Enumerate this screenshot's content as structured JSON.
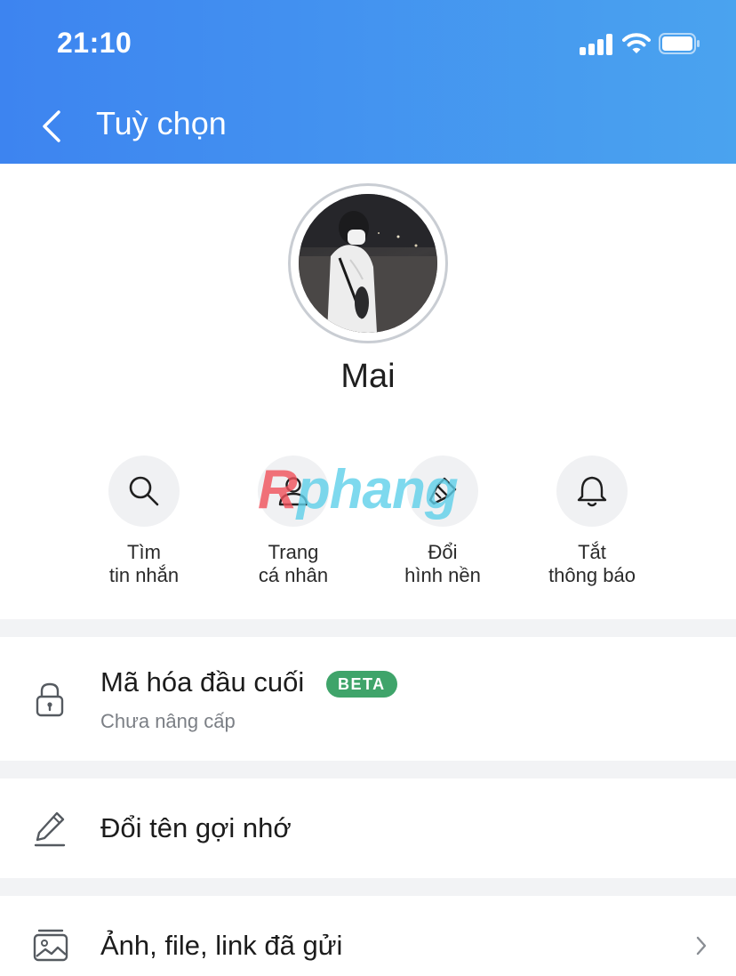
{
  "status_bar": {
    "time": "21:10"
  },
  "header": {
    "title": "Tuỳ chọn"
  },
  "profile": {
    "name": "Mai"
  },
  "actions": [
    {
      "line1": "Tìm",
      "line2": "tin nhắn",
      "icon": "search-icon"
    },
    {
      "line1": "Trang",
      "line2": "cá nhân",
      "icon": "person-icon"
    },
    {
      "line1": "Đổi",
      "line2": "hình nền",
      "icon": "paint-brush-icon"
    },
    {
      "line1": "Tắt",
      "line2": "thông báo",
      "icon": "bell-icon"
    }
  ],
  "watermark": {
    "prefix": "R",
    "rest": "phang"
  },
  "settings": {
    "encryption": {
      "label": "Mã hóa đầu cuối",
      "badge": "BETA",
      "status": "Chưa nâng cấp",
      "icon": "lock-icon"
    },
    "rename": {
      "label": "Đổi tên gợi nhớ",
      "icon": "pencil-icon"
    },
    "media": {
      "label": "Ảnh, file, link đã gửi",
      "icon": "gallery-icon"
    }
  },
  "colors": {
    "header_start": "#3d84f0",
    "header_end": "#4aa3ef",
    "badge": "#3fa46a",
    "separator": "#f2f3f5"
  }
}
